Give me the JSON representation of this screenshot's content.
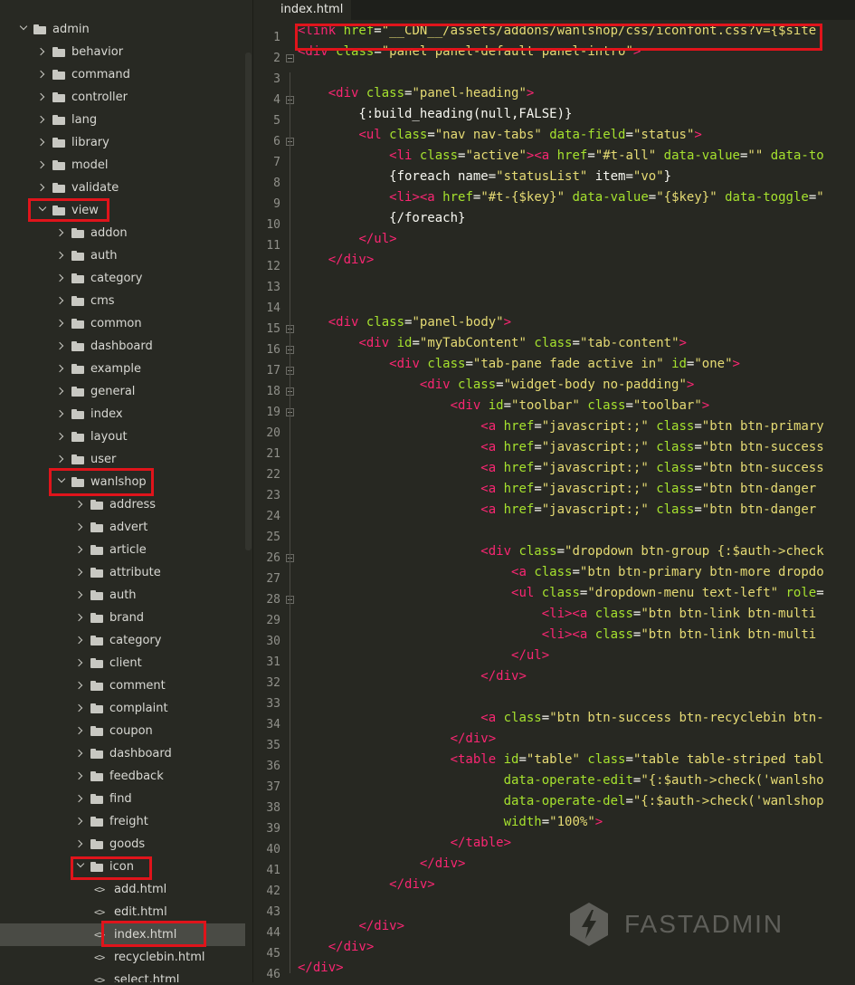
{
  "tab": {
    "label": "index.html"
  },
  "tree": [
    {
      "label": "admin",
      "kind": "folder",
      "open": true,
      "depth": 0
    },
    {
      "label": "behavior",
      "kind": "folder",
      "open": false,
      "depth": 1
    },
    {
      "label": "command",
      "kind": "folder",
      "open": false,
      "depth": 1
    },
    {
      "label": "controller",
      "kind": "folder",
      "open": false,
      "depth": 1
    },
    {
      "label": "lang",
      "kind": "folder",
      "open": false,
      "depth": 1
    },
    {
      "label": "library",
      "kind": "folder",
      "open": false,
      "depth": 1
    },
    {
      "label": "model",
      "kind": "folder",
      "open": false,
      "depth": 1
    },
    {
      "label": "validate",
      "kind": "folder",
      "open": false,
      "depth": 1
    },
    {
      "label": "view",
      "kind": "folder",
      "open": true,
      "depth": 1
    },
    {
      "label": "addon",
      "kind": "folder",
      "open": false,
      "depth": 2
    },
    {
      "label": "auth",
      "kind": "folder",
      "open": false,
      "depth": 2
    },
    {
      "label": "category",
      "kind": "folder",
      "open": false,
      "depth": 2
    },
    {
      "label": "cms",
      "kind": "folder",
      "open": false,
      "depth": 2
    },
    {
      "label": "common",
      "kind": "folder",
      "open": false,
      "depth": 2
    },
    {
      "label": "dashboard",
      "kind": "folder",
      "open": false,
      "depth": 2
    },
    {
      "label": "example",
      "kind": "folder",
      "open": false,
      "depth": 2
    },
    {
      "label": "general",
      "kind": "folder",
      "open": false,
      "depth": 2
    },
    {
      "label": "index",
      "kind": "folder",
      "open": false,
      "depth": 2
    },
    {
      "label": "layout",
      "kind": "folder",
      "open": false,
      "depth": 2
    },
    {
      "label": "user",
      "kind": "folder",
      "open": false,
      "depth": 2
    },
    {
      "label": "wanlshop",
      "kind": "folder",
      "open": true,
      "depth": 2
    },
    {
      "label": "address",
      "kind": "folder",
      "open": false,
      "depth": 3
    },
    {
      "label": "advert",
      "kind": "folder",
      "open": false,
      "depth": 3
    },
    {
      "label": "article",
      "kind": "folder",
      "open": false,
      "depth": 3
    },
    {
      "label": "attribute",
      "kind": "folder",
      "open": false,
      "depth": 3
    },
    {
      "label": "auth",
      "kind": "folder",
      "open": false,
      "depth": 3
    },
    {
      "label": "brand",
      "kind": "folder",
      "open": false,
      "depth": 3
    },
    {
      "label": "category",
      "kind": "folder",
      "open": false,
      "depth": 3
    },
    {
      "label": "client",
      "kind": "folder",
      "open": false,
      "depth": 3
    },
    {
      "label": "comment",
      "kind": "folder",
      "open": false,
      "depth": 3
    },
    {
      "label": "complaint",
      "kind": "folder",
      "open": false,
      "depth": 3
    },
    {
      "label": "coupon",
      "kind": "folder",
      "open": false,
      "depth": 3
    },
    {
      "label": "dashboard",
      "kind": "folder",
      "open": false,
      "depth": 3
    },
    {
      "label": "feedback",
      "kind": "folder",
      "open": false,
      "depth": 3
    },
    {
      "label": "find",
      "kind": "folder",
      "open": false,
      "depth": 3
    },
    {
      "label": "freight",
      "kind": "folder",
      "open": false,
      "depth": 3
    },
    {
      "label": "goods",
      "kind": "folder",
      "open": false,
      "depth": 3
    },
    {
      "label": "icon",
      "kind": "folder",
      "open": true,
      "depth": 3
    },
    {
      "label": "add.html",
      "kind": "file",
      "depth": 4
    },
    {
      "label": "edit.html",
      "kind": "file",
      "depth": 4
    },
    {
      "label": "index.html",
      "kind": "file",
      "depth": 4,
      "selected": true
    },
    {
      "label": "recyclebin.html",
      "kind": "file",
      "depth": 4
    },
    {
      "label": "select.html",
      "kind": "file",
      "depth": 4
    }
  ],
  "file_icon_glyph": "<>",
  "code_lines": [
    [
      [
        "t",
        "<link "
      ],
      [
        "a",
        "href"
      ],
      [
        "p",
        "="
      ],
      [
        "s",
        "\"__CDN__/assets/addons/wanlshop/css/iconfont.css?v={$site"
      ]
    ],
    [
      [
        "t",
        "<div "
      ],
      [
        "a",
        "class"
      ],
      [
        "p",
        "="
      ],
      [
        "s",
        "\"panel panel-default panel-intro\""
      ],
      [
        "t",
        ">"
      ]
    ],
    [],
    [
      [
        "p",
        "    "
      ],
      [
        "t",
        "<div "
      ],
      [
        "a",
        "class"
      ],
      [
        "p",
        "="
      ],
      [
        "s",
        "\"panel-heading\""
      ],
      [
        "t",
        ">"
      ]
    ],
    [
      [
        "p",
        "        {:build_heading(null,FALSE)}"
      ]
    ],
    [
      [
        "p",
        "        "
      ],
      [
        "t",
        "<ul "
      ],
      [
        "a",
        "class"
      ],
      [
        "p",
        "="
      ],
      [
        "s",
        "\"nav nav-tabs\""
      ],
      [
        "p",
        " "
      ],
      [
        "a",
        "data-field"
      ],
      [
        "p",
        "="
      ],
      [
        "s",
        "\"status\""
      ],
      [
        "t",
        ">"
      ]
    ],
    [
      [
        "p",
        "            "
      ],
      [
        "t",
        "<li "
      ],
      [
        "a",
        "class"
      ],
      [
        "p",
        "="
      ],
      [
        "s",
        "\"active\""
      ],
      [
        "t",
        "><a "
      ],
      [
        "a",
        "href"
      ],
      [
        "p",
        "="
      ],
      [
        "s",
        "\"#t-all\""
      ],
      [
        "p",
        " "
      ],
      [
        "a",
        "data-value"
      ],
      [
        "p",
        "="
      ],
      [
        "s",
        "\"\""
      ],
      [
        "p",
        " "
      ],
      [
        "a",
        "data-to"
      ]
    ],
    [
      [
        "p",
        "            {foreach name="
      ],
      [
        "s",
        "\"statusList\""
      ],
      [
        "p",
        " item="
      ],
      [
        "s",
        "\"vo\""
      ],
      [
        "p",
        "}"
      ]
    ],
    [
      [
        "p",
        "            "
      ],
      [
        "t",
        "<li><a "
      ],
      [
        "a",
        "href"
      ],
      [
        "p",
        "="
      ],
      [
        "s",
        "\"#t-{$key}\""
      ],
      [
        "p",
        " "
      ],
      [
        "a",
        "data-value"
      ],
      [
        "p",
        "="
      ],
      [
        "s",
        "\"{$key}\""
      ],
      [
        "p",
        " "
      ],
      [
        "a",
        "data-toggle"
      ],
      [
        "p",
        "="
      ],
      [
        "s",
        "\""
      ]
    ],
    [
      [
        "p",
        "            {/foreach}"
      ]
    ],
    [
      [
        "p",
        "        "
      ],
      [
        "t",
        "</ul>"
      ]
    ],
    [
      [
        "p",
        "    "
      ],
      [
        "t",
        "</div>"
      ]
    ],
    [],
    [],
    [
      [
        "p",
        "    "
      ],
      [
        "t",
        "<div "
      ],
      [
        "a",
        "class"
      ],
      [
        "p",
        "="
      ],
      [
        "s",
        "\"panel-body\""
      ],
      [
        "t",
        ">"
      ]
    ],
    [
      [
        "p",
        "        "
      ],
      [
        "t",
        "<div "
      ],
      [
        "a",
        "id"
      ],
      [
        "p",
        "="
      ],
      [
        "s",
        "\"myTabContent\""
      ],
      [
        "p",
        " "
      ],
      [
        "a",
        "class"
      ],
      [
        "p",
        "="
      ],
      [
        "s",
        "\"tab-content\""
      ],
      [
        "t",
        ">"
      ]
    ],
    [
      [
        "p",
        "            "
      ],
      [
        "t",
        "<div "
      ],
      [
        "a",
        "class"
      ],
      [
        "p",
        "="
      ],
      [
        "s",
        "\"tab-pane fade active in\""
      ],
      [
        "p",
        " "
      ],
      [
        "a",
        "id"
      ],
      [
        "p",
        "="
      ],
      [
        "s",
        "\"one\""
      ],
      [
        "t",
        ">"
      ]
    ],
    [
      [
        "p",
        "                "
      ],
      [
        "t",
        "<div "
      ],
      [
        "a",
        "class"
      ],
      [
        "p",
        "="
      ],
      [
        "s",
        "\"widget-body no-padding\""
      ],
      [
        "t",
        ">"
      ]
    ],
    [
      [
        "p",
        "                    "
      ],
      [
        "t",
        "<div "
      ],
      [
        "a",
        "id"
      ],
      [
        "p",
        "="
      ],
      [
        "s",
        "\"toolbar\""
      ],
      [
        "p",
        " "
      ],
      [
        "a",
        "class"
      ],
      [
        "p",
        "="
      ],
      [
        "s",
        "\"toolbar\""
      ],
      [
        "t",
        ">"
      ]
    ],
    [
      [
        "p",
        "                        "
      ],
      [
        "t",
        "<a "
      ],
      [
        "a",
        "href"
      ],
      [
        "p",
        "="
      ],
      [
        "s",
        "\"javascript:;\""
      ],
      [
        "p",
        " "
      ],
      [
        "a",
        "class"
      ],
      [
        "p",
        "="
      ],
      [
        "s",
        "\"btn btn-primary"
      ]
    ],
    [
      [
        "p",
        "                        "
      ],
      [
        "t",
        "<a "
      ],
      [
        "a",
        "href"
      ],
      [
        "p",
        "="
      ],
      [
        "s",
        "\"javascript:;\""
      ],
      [
        "p",
        " "
      ],
      [
        "a",
        "class"
      ],
      [
        "p",
        "="
      ],
      [
        "s",
        "\"btn btn-success"
      ]
    ],
    [
      [
        "p",
        "                        "
      ],
      [
        "t",
        "<a "
      ],
      [
        "a",
        "href"
      ],
      [
        "p",
        "="
      ],
      [
        "s",
        "\"javascript:;\""
      ],
      [
        "p",
        " "
      ],
      [
        "a",
        "class"
      ],
      [
        "p",
        "="
      ],
      [
        "s",
        "\"btn btn-success"
      ]
    ],
    [
      [
        "p",
        "                        "
      ],
      [
        "t",
        "<a "
      ],
      [
        "a",
        "href"
      ],
      [
        "p",
        "="
      ],
      [
        "s",
        "\"javascript:;\""
      ],
      [
        "p",
        " "
      ],
      [
        "a",
        "class"
      ],
      [
        "p",
        "="
      ],
      [
        "s",
        "\"btn btn-danger "
      ]
    ],
    [
      [
        "p",
        "                        "
      ],
      [
        "t",
        "<a "
      ],
      [
        "a",
        "href"
      ],
      [
        "p",
        "="
      ],
      [
        "s",
        "\"javascript:;\""
      ],
      [
        "p",
        " "
      ],
      [
        "a",
        "class"
      ],
      [
        "p",
        "="
      ],
      [
        "s",
        "\"btn btn-danger "
      ]
    ],
    [],
    [
      [
        "p",
        "                        "
      ],
      [
        "t",
        "<div "
      ],
      [
        "a",
        "class"
      ],
      [
        "p",
        "="
      ],
      [
        "s",
        "\"dropdown btn-group {:$auth->check"
      ]
    ],
    [
      [
        "p",
        "                            "
      ],
      [
        "t",
        "<a "
      ],
      [
        "a",
        "class"
      ],
      [
        "p",
        "="
      ],
      [
        "s",
        "\"btn btn-primary btn-more dropdo"
      ]
    ],
    [
      [
        "p",
        "                            "
      ],
      [
        "t",
        "<ul "
      ],
      [
        "a",
        "class"
      ],
      [
        "p",
        "="
      ],
      [
        "s",
        "\"dropdown-menu text-left\""
      ],
      [
        "p",
        " "
      ],
      [
        "a",
        "role"
      ],
      [
        "p",
        "="
      ]
    ],
    [
      [
        "p",
        "                                "
      ],
      [
        "t",
        "<li><a "
      ],
      [
        "a",
        "class"
      ],
      [
        "p",
        "="
      ],
      [
        "s",
        "\"btn btn-link btn-multi "
      ]
    ],
    [
      [
        "p",
        "                                "
      ],
      [
        "t",
        "<li><a "
      ],
      [
        "a",
        "class"
      ],
      [
        "p",
        "="
      ],
      [
        "s",
        "\"btn btn-link btn-multi "
      ]
    ],
    [
      [
        "p",
        "                            "
      ],
      [
        "t",
        "</ul>"
      ]
    ],
    [
      [
        "p",
        "                        "
      ],
      [
        "t",
        "</div>"
      ]
    ],
    [],
    [
      [
        "p",
        "                        "
      ],
      [
        "t",
        "<a "
      ],
      [
        "a",
        "class"
      ],
      [
        "p",
        "="
      ],
      [
        "s",
        "\"btn btn-success btn-recyclebin btn-"
      ]
    ],
    [
      [
        "p",
        "                    "
      ],
      [
        "t",
        "</div>"
      ]
    ],
    [
      [
        "p",
        "                    "
      ],
      [
        "t",
        "<table "
      ],
      [
        "a",
        "id"
      ],
      [
        "p",
        "="
      ],
      [
        "s",
        "\"table\""
      ],
      [
        "p",
        " "
      ],
      [
        "a",
        "class"
      ],
      [
        "p",
        "="
      ],
      [
        "s",
        "\"table table-striped tabl"
      ]
    ],
    [
      [
        "p",
        "                           "
      ],
      [
        "a",
        "data-operate-edit"
      ],
      [
        "p",
        "="
      ],
      [
        "s",
        "\"{:$auth->check('wanlsho"
      ]
    ],
    [
      [
        "p",
        "                           "
      ],
      [
        "a",
        "data-operate-del"
      ],
      [
        "p",
        "="
      ],
      [
        "s",
        "\"{:$auth->check('wanlshop"
      ]
    ],
    [
      [
        "p",
        "                           "
      ],
      [
        "a",
        "width"
      ],
      [
        "p",
        "="
      ],
      [
        "s",
        "\"100%\""
      ],
      [
        "t",
        ">"
      ]
    ],
    [
      [
        "p",
        "                    "
      ],
      [
        "t",
        "</table>"
      ]
    ],
    [
      [
        "p",
        "                "
      ],
      [
        "t",
        "</div>"
      ]
    ],
    [
      [
        "p",
        "            "
      ],
      [
        "t",
        "</div>"
      ]
    ],
    [],
    [
      [
        "p",
        "        "
      ],
      [
        "t",
        "</div>"
      ]
    ],
    [
      [
        "p",
        "    "
      ],
      [
        "t",
        "</div>"
      ]
    ],
    [
      [
        "t",
        "</div>"
      ]
    ]
  ],
  "fold_lines": [
    2,
    4,
    6,
    15,
    16,
    17,
    18,
    19,
    26,
    28
  ],
  "watermark": {
    "text": "FASTADMIN"
  },
  "colors": {
    "tag": "#f92672",
    "attr": "#a6e22e",
    "string": "#e6db74",
    "text": "#f8f8f2",
    "highlight": "#e0141b",
    "background": "#272822"
  }
}
